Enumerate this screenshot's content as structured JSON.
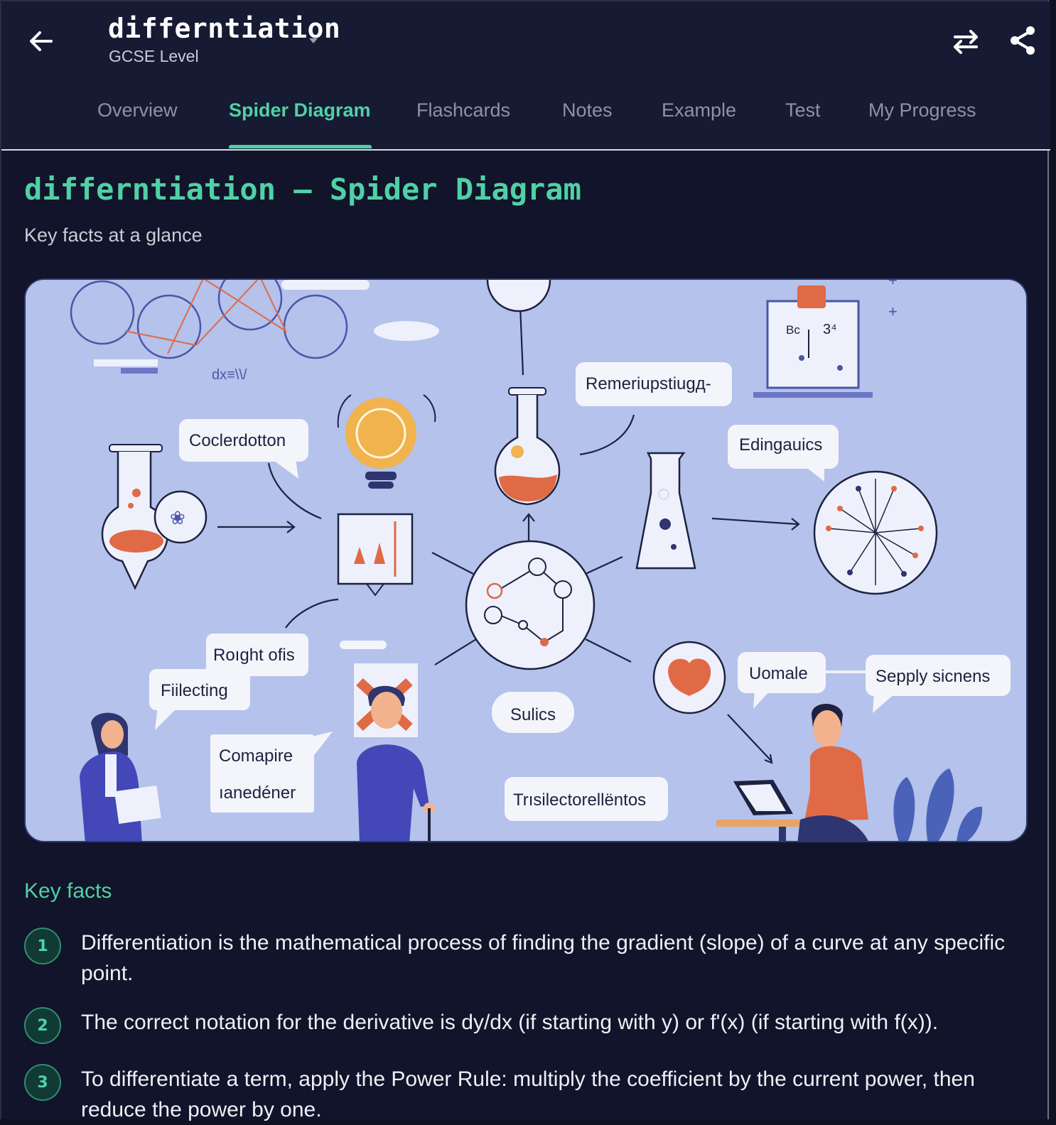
{
  "header": {
    "title": "differntiation",
    "subtitle": "GCSE Level"
  },
  "tabs": [
    {
      "label": "Overview",
      "active": false
    },
    {
      "label": "Spider Diagram",
      "active": true
    },
    {
      "label": "Flashcards",
      "active": false
    },
    {
      "label": "Notes",
      "active": false
    },
    {
      "label": "Example",
      "active": false
    },
    {
      "label": "Test",
      "active": false
    },
    {
      "label": "My Progress",
      "active": false
    }
  ],
  "page": {
    "title": "differntiation – Spider Diagram",
    "subtitle": "Key facts at a glance"
  },
  "diagram": {
    "labels": {
      "formula": "dx≡\\\\/",
      "l1": "Remeriupstiugд-",
      "l2": "Coclerdotton",
      "l3": "Edingauics",
      "l4": "Roıght ofis",
      "l5": "Fiilecting",
      "l6": "Comapire",
      "l7": "ıanedéner",
      "l8": "Sulics",
      "l9": "Uomale",
      "l10": "Sepply sicnens",
      "l11": "Trısilectorellёntos",
      "board1": "Bc",
      "board2": "3⁴"
    }
  },
  "key_facts": {
    "title": "Key facts",
    "items": [
      {
        "n": "1",
        "text": "Differentiation is the mathematical process of finding the gradient (slope) of a curve at any specific point."
      },
      {
        "n": "2",
        "text": "The correct notation for the derivative is dy/dx (if starting with y) or f'(x) (if starting with f(x))."
      },
      {
        "n": "3",
        "text": "To differentiate a term, apply the Power Rule: multiply the coefficient by the current power, then reduce the power by one."
      }
    ]
  },
  "colors": {
    "accent": "#4fd1a5",
    "background": "#11142a",
    "illustration_bg": "#b4c2ec",
    "illustration_orange": "#e06a45",
    "illustration_navy": "#2e3570"
  },
  "icons": [
    "back-arrow-icon",
    "dropdown-caret-icon",
    "swap-icon",
    "share-icon"
  ]
}
